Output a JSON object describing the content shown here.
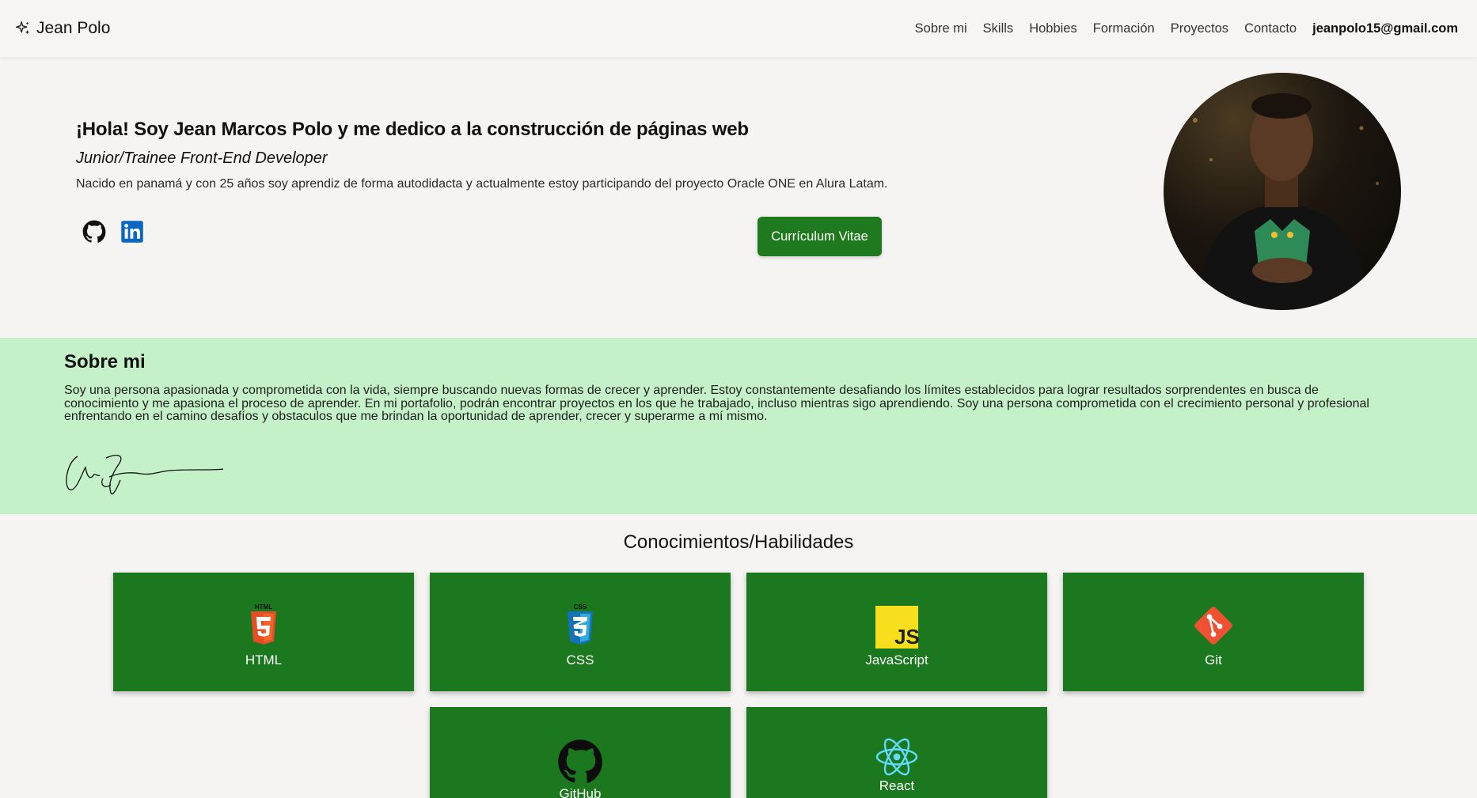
{
  "header": {
    "brand": "Jean Polo",
    "nav": [
      "Sobre mi",
      "Skills",
      "Hobbies",
      "Formación",
      "Proyectos",
      "Contacto"
    ],
    "email": "jeanpolo15@gmail.com"
  },
  "hero": {
    "title": "¡Hola! Soy Jean Marcos Polo y me dedico a la construcción de páginas web",
    "subtitle": "Junior/Trainee Front-End Developer",
    "description": "Nacido en panamá y con 25 años soy aprendiz de forma autodidacta y actualmente estoy participando del proyecto Oracle ONE en Alura Latam.",
    "cv_button": "Currículum Vitae",
    "socials": [
      "github-icon",
      "linkedin-icon"
    ]
  },
  "about": {
    "title": "Sobre mi",
    "text": "Soy una persona apasionada y comprometida con la vida, siempre buscando nuevas formas de crecer y aprender. Estoy constantemente desafiando los límites establecidos para lograr resultados sorprendentes en busca de conocimiento y me apasiona el proceso de aprender. En mi portafolio, podrán encontrar proyectos en los que he trabajado, incluso mientras sigo aprendiendo. Soy una persona comprometida con el crecimiento personal y profesional enfrentando en el camino desafíos y obstaculos que me brindan la oportunidad de aprender, crecer y superarme a mí mismo."
  },
  "skills": {
    "title": "Conocimientos/Habilidades",
    "items": [
      {
        "label": "HTML",
        "icon": "html5-icon"
      },
      {
        "label": "CSS",
        "icon": "css3-icon"
      },
      {
        "label": "JavaScript",
        "icon": "javascript-icon"
      },
      {
        "label": "Git",
        "icon": "git-icon"
      },
      {
        "label": "GitHub",
        "icon": "github-icon"
      },
      {
        "label": "React",
        "icon": "react-icon"
      }
    ]
  },
  "colors": {
    "accent": "#1f7a1f",
    "about_bg": "#c4f1c8",
    "page_bg": "#f5f4f2"
  }
}
